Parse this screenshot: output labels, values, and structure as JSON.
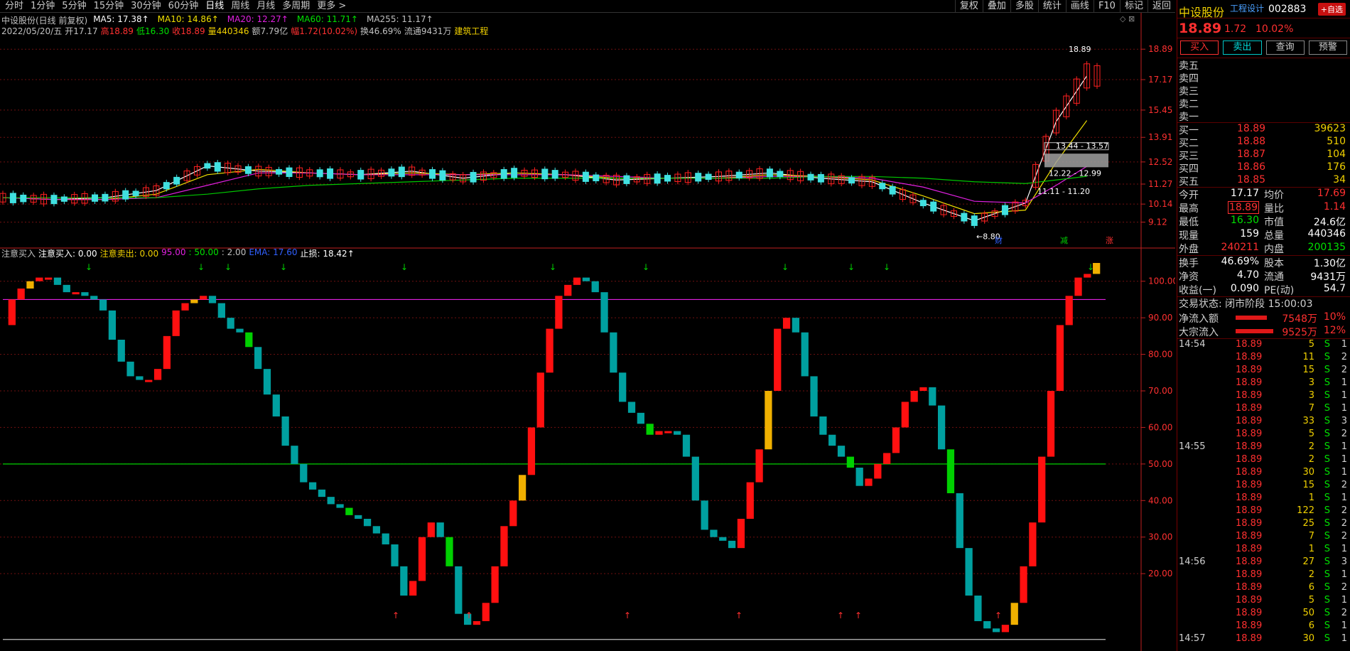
{
  "toolbar": {
    "periods": [
      "分时",
      "1分钟",
      "5分钟",
      "15分钟",
      "30分钟",
      "60分钟",
      "日线",
      "周线",
      "月线",
      "多周期",
      "更多 >"
    ],
    "active_period": "日线",
    "functions": [
      "复权",
      "叠加",
      "多股",
      "统计",
      "画线",
      "F10",
      "标记",
      "返回"
    ]
  },
  "header": {
    "title": "中设股份(日线 前复权)",
    "ma": [
      {
        "label": "MA5: 17.38↑",
        "color": "#ffffff"
      },
      {
        "label": "MA10: 14.86↑",
        "color": "#f0e000"
      },
      {
        "label": "MA20: 12.27↑",
        "color": "#e020e0"
      },
      {
        "label": "MA60: 11.71↑",
        "color": "#00e000"
      },
      {
        "label": "MA255: 11.17↑",
        "color": "#c0c0c0"
      }
    ],
    "info": [
      {
        "text": "2022/05/20/五",
        "color": "#c0c0c0"
      },
      {
        "text": "开17.17",
        "color": "#c0c0c0"
      },
      {
        "text": "高18.89",
        "color": "#ff3030"
      },
      {
        "text": "低16.30",
        "color": "#00e000"
      },
      {
        "text": "收18.89",
        "color": "#ff3030"
      },
      {
        "text": "量440346",
        "color": "#f0d000"
      },
      {
        "text": "额7.79亿",
        "color": "#c0c0c0"
      },
      {
        "text": "幅1.72(10.02%)",
        "color": "#ff3030"
      },
      {
        "text": "换46.69%",
        "color": "#c0c0c0"
      },
      {
        "text": "流通9431万",
        "color": "#c0c0c0"
      },
      {
        "text": "建筑工程",
        "color": "#f0d000"
      }
    ]
  },
  "indicator_header": [
    {
      "text": "注意买入",
      "color": "#c0c0c0"
    },
    {
      "text": "注意买入: 0.00",
      "color": "#ffffff"
    },
    {
      "text": "注意卖出: 0.00",
      "color": "#f0d000"
    },
    {
      "text": "95.00",
      "color": "#e020e0"
    },
    {
      "text": ": 50.00",
      "color": "#00e000"
    },
    {
      "text": ": 2.00",
      "color": "#c0c0c0"
    },
    {
      "text": "EMA: 17.60",
      "color": "#3060ff"
    },
    {
      "text": "止损: 18.42↑",
      "color": "#ffffff"
    }
  ],
  "price_chart": {
    "type": "candlestick",
    "y_axis_ticks": [
      "18.89",
      "17.17",
      "15.45",
      "13.91",
      "12.52",
      "11.27",
      "10.14",
      "9.12"
    ],
    "annotations": {
      "high_label": "18.89",
      "low_label": "8.80",
      "zone_top": "13.44 - 13.57",
      "zone_mid": "12.22 - 12.99",
      "zone_low": "11.11 - 11.20"
    },
    "markers": [
      "财",
      "减",
      "涨"
    ]
  },
  "indicator_chart": {
    "type": "bar",
    "y_axis_ticks": [
      "100.00",
      "90.00",
      "80.00",
      "70.00",
      "60.00",
      "50.00",
      "40.00",
      "30.00",
      "20.00"
    ],
    "y_range": [
      0,
      105
    ],
    "ref_lines": [
      95,
      50,
      2
    ],
    "colors": {
      "rising": "#ff1010",
      "falling": "#00a0a0",
      "buy_zone": "#f0b000",
      "sell_zone": "#00d000"
    }
  },
  "quote_panel": {
    "name": "中设股份",
    "concept": "工程设计",
    "code": "002883",
    "fav_button": "+自选",
    "last": "18.89",
    "change": "1.72",
    "change_pct": "10.02%",
    "buttons": [
      "买入",
      "卖出",
      "查询",
      "预警"
    ],
    "sells": [
      {
        "label": "卖五",
        "price": "",
        "vol": ""
      },
      {
        "label": "卖四",
        "price": "",
        "vol": ""
      },
      {
        "label": "卖三",
        "price": "",
        "vol": ""
      },
      {
        "label": "卖二",
        "price": "",
        "vol": ""
      },
      {
        "label": "卖一",
        "price": "",
        "vol": ""
      }
    ],
    "buys": [
      {
        "label": "买一",
        "price": "18.89",
        "vol": "39623"
      },
      {
        "label": "买二",
        "price": "18.88",
        "vol": "510"
      },
      {
        "label": "买三",
        "price": "18.87",
        "vol": "104"
      },
      {
        "label": "买四",
        "price": "18.86",
        "vol": "176"
      },
      {
        "label": "买五",
        "price": "18.85",
        "vol": "34"
      }
    ],
    "stats": [
      {
        "l1": "今开",
        "v1": "17.17",
        "c1": "wht",
        "l2": "均价",
        "v2": "17.69",
        "c2": "red"
      },
      {
        "l1": "最高",
        "v1": "18.89",
        "c1": "red",
        "b1": true,
        "l2": "量比",
        "v2": "1.14",
        "c2": "red"
      },
      {
        "l1": "最低",
        "v1": "16.30",
        "c1": "grn",
        "l2": "市值",
        "v2": "24.6亿",
        "c2": "wht"
      },
      {
        "l1": "现量",
        "v1": "159",
        "c1": "wht",
        "l2": "总量",
        "v2": "440346",
        "c2": "wht"
      },
      {
        "l1": "外盘",
        "v1": "240211",
        "c1": "red",
        "l2": "内盘",
        "v2": "200135",
        "c2": "grn"
      }
    ],
    "stats2": [
      {
        "l1": "换手",
        "v1": "46.69%",
        "c1": "wht",
        "l2": "股本",
        "v2": "1.30亿",
        "c2": "wht"
      },
      {
        "l1": "净资",
        "v1": "4.70",
        "c1": "wht",
        "l2": "流通",
        "v2": "9431万",
        "c2": "wht"
      },
      {
        "l1": "收益(一)",
        "v1": "0.090",
        "c1": "wht",
        "l2": "PE(动)",
        "v2": "54.7",
        "c2": "wht"
      }
    ],
    "trade_state": "交易状态: 闭市阶段 15:00:03",
    "flows": [
      {
        "label": "净流入额",
        "value": "7548万",
        "pct": "10%",
        "bar": 0.34
      },
      {
        "label": "大宗流入",
        "value": "9525万",
        "pct": "12%",
        "bar": 0.41
      }
    ],
    "ticks": [
      {
        "time": "14:54",
        "price": "18.89",
        "vol": "5",
        "side": "S",
        "cnt": "1"
      },
      {
        "time": "",
        "price": "18.89",
        "vol": "11",
        "side": "S",
        "cnt": "2"
      },
      {
        "time": "",
        "price": "18.89",
        "vol": "15",
        "side": "S",
        "cnt": "2"
      },
      {
        "time": "",
        "price": "18.89",
        "vol": "3",
        "side": "S",
        "cnt": "1"
      },
      {
        "time": "",
        "price": "18.89",
        "vol": "3",
        "side": "S",
        "cnt": "1"
      },
      {
        "time": "",
        "price": "18.89",
        "vol": "7",
        "side": "S",
        "cnt": "1"
      },
      {
        "time": "",
        "price": "18.89",
        "vol": "33",
        "side": "S",
        "cnt": "3"
      },
      {
        "time": "",
        "price": "18.89",
        "vol": "5",
        "side": "S",
        "cnt": "2"
      },
      {
        "time": "14:55",
        "price": "18.89",
        "vol": "2",
        "side": "S",
        "cnt": "1"
      },
      {
        "time": "",
        "price": "18.89",
        "vol": "2",
        "side": "S",
        "cnt": "1"
      },
      {
        "time": "",
        "price": "18.89",
        "vol": "30",
        "side": "S",
        "cnt": "1"
      },
      {
        "time": "",
        "price": "18.89",
        "vol": "15",
        "side": "S",
        "cnt": "2"
      },
      {
        "time": "",
        "price": "18.89",
        "vol": "1",
        "side": "S",
        "cnt": "1"
      },
      {
        "time": "",
        "price": "18.89",
        "vol": "122",
        "side": "S",
        "cnt": "2"
      },
      {
        "time": "",
        "price": "18.89",
        "vol": "25",
        "side": "S",
        "cnt": "2"
      },
      {
        "time": "",
        "price": "18.89",
        "vol": "7",
        "side": "S",
        "cnt": "2"
      },
      {
        "time": "",
        "price": "18.89",
        "vol": "1",
        "side": "S",
        "cnt": "1"
      },
      {
        "time": "14:56",
        "price": "18.89",
        "vol": "27",
        "side": "S",
        "cnt": "3"
      },
      {
        "time": "",
        "price": "18.89",
        "vol": "2",
        "side": "S",
        "cnt": "1"
      },
      {
        "time": "",
        "price": "18.89",
        "vol": "6",
        "side": "S",
        "cnt": "2"
      },
      {
        "time": "",
        "price": "18.89",
        "vol": "5",
        "side": "S",
        "cnt": "1"
      },
      {
        "time": "",
        "price": "18.89",
        "vol": "50",
        "side": "S",
        "cnt": "2"
      },
      {
        "time": "",
        "price": "18.89",
        "vol": "6",
        "side": "S",
        "cnt": "1"
      },
      {
        "time": "14:57",
        "price": "18.89",
        "vol": "30",
        "side": "S",
        "cnt": "1"
      }
    ]
  },
  "chart_data": [
    {
      "type": "line",
      "title": "中设股份(日线 前复权)",
      "ylim": [
        8.5,
        19.5
      ],
      "x": [
        1,
        6,
        11,
        16,
        21,
        26,
        31,
        36,
        41,
        46,
        51,
        56,
        61,
        66,
        71,
        76,
        81,
        86,
        91,
        96,
        101,
        104,
        107
      ],
      "series": [
        {
          "name": "MA5",
          "values": [
            10.5,
            10.4,
            10.5,
            10.9,
            12.3,
            12.0,
            11.9,
            11.8,
            12.0,
            11.6,
            11.9,
            11.8,
            11.5,
            11.6,
            11.7,
            11.9,
            11.6,
            11.4,
            10.2,
            9.2,
            10.2,
            14.8,
            17.38
          ]
        },
        {
          "name": "MA10",
          "values": [
            10.5,
            10.4,
            10.4,
            10.7,
            11.8,
            12.1,
            11.9,
            11.8,
            11.9,
            11.8,
            11.9,
            11.8,
            11.6,
            11.6,
            11.6,
            11.8,
            11.7,
            11.5,
            10.6,
            9.6,
            9.8,
            12.5,
            14.86
          ]
        },
        {
          "name": "MA20",
          "values": [
            10.5,
            10.4,
            10.4,
            10.5,
            11.2,
            11.9,
            11.9,
            11.8,
            11.8,
            11.8,
            11.8,
            11.8,
            11.7,
            11.6,
            11.6,
            11.7,
            11.7,
            11.6,
            11.1,
            10.3,
            10.2,
            11.2,
            12.27
          ]
        },
        {
          "name": "MA60",
          "values": [
            10.5,
            10.5,
            10.5,
            10.5,
            10.7,
            11.0,
            11.2,
            11.3,
            11.4,
            11.5,
            11.6,
            11.6,
            11.6,
            11.6,
            11.6,
            11.6,
            11.7,
            11.7,
            11.6,
            11.4,
            11.3,
            11.5,
            11.71
          ]
        }
      ]
    },
    {
      "type": "bar",
      "title": "",
      "ylim": [
        0,
        105
      ],
      "values": [
        88,
        95,
        98,
        100,
        101,
        101,
        99,
        97,
        97,
        96,
        95,
        92,
        84,
        78,
        74,
        73,
        73,
        76,
        85,
        92,
        94,
        95,
        96,
        94,
        90,
        87,
        86,
        82,
        76,
        69,
        63,
        55,
        50,
        45,
        43,
        41,
        39,
        38,
        36,
        35,
        33,
        31,
        28,
        22,
        14,
        18,
        30,
        34,
        30,
        22,
        9,
        6,
        7,
        12,
        22,
        33,
        40,
        47,
        60,
        75,
        87,
        96,
        99,
        101,
        100,
        97,
        86,
        75,
        67,
        64,
        61,
        58,
        59,
        59,
        58,
        52,
        40,
        32,
        30,
        29,
        27,
        35,
        45,
        54,
        70,
        87,
        90,
        86,
        74,
        63,
        58,
        55,
        52,
        49,
        44,
        46,
        50,
        53,
        60,
        67,
        70,
        71,
        66,
        54,
        42,
        27,
        14,
        7,
        5,
        4,
        6,
        12,
        22,
        34,
        52,
        70,
        88,
        96,
        101,
        102,
        105
      ]
    }
  ]
}
